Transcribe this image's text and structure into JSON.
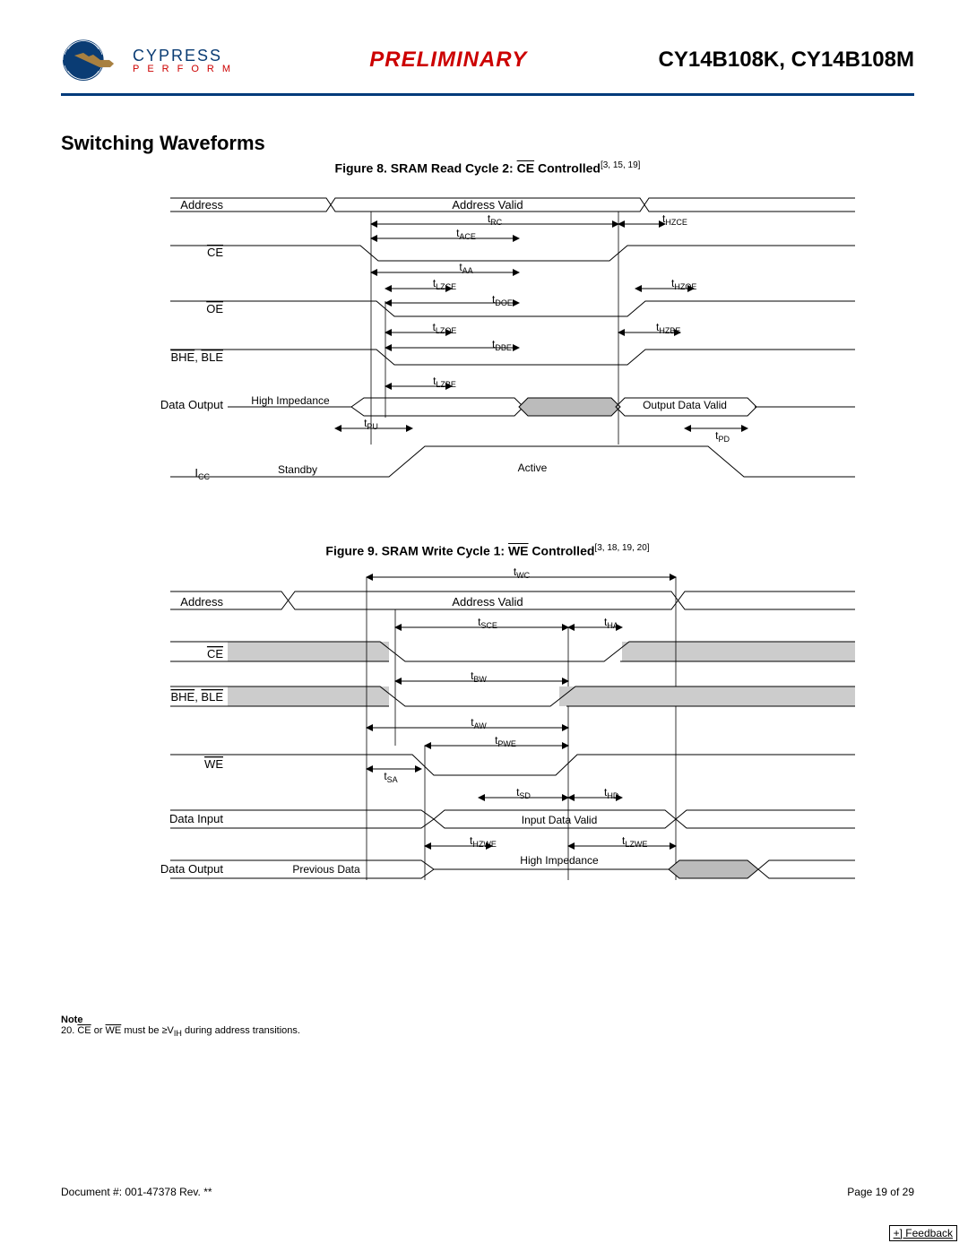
{
  "header": {
    "company": "CYPRESS",
    "tagline": "PERFORM",
    "preliminary": "PRELIMINARY",
    "parts": "CY14B108K, CY14B108M"
  },
  "section_title": "Switching Waveforms",
  "figure8": {
    "caption_prefix": "Figure 8.  SRAM Read Cycle 2: ",
    "caption_bar": "CE",
    "caption_suffix": " Controlled",
    "refs": "[3, 15, 19]",
    "signals": {
      "address": "Address",
      "address_valid": "Address Valid",
      "ce": "CE",
      "oe": "OE",
      "bhe_ble": "BHE, BLE",
      "data_output": "Data Output",
      "high_impedance": "High Impedance",
      "output_data_valid": "Output Data Valid",
      "icc": "I",
      "icc_sub": "CC",
      "standby": "Standby",
      "active": "Active"
    },
    "timing": {
      "tRC": "t",
      "tRC_sub": "RC",
      "tACE": "t",
      "tACE_sub": "ACE",
      "tHZCE": "t",
      "tHZCE_sub": "HZCE",
      "tAA": "t",
      "tAA_sub": "AA",
      "tLZCE": "t",
      "tLZCE_sub": "LZCE",
      "tHZOE": "t",
      "tHZOE_sub": "HZOE",
      "tDOE": "t",
      "tDOE_sub": "DOE",
      "tLZOE": "t",
      "tLZOE_sub": "LZOE",
      "tHZBE": "t",
      "tHZBE_sub": "HZBE",
      "tDBE": "t",
      "tDBE_sub": "DBE",
      "tLZBE": "t",
      "tLZBE_sub": "LZBE",
      "tPU": "t",
      "tPU_sub": "PU",
      "tPD": "t",
      "tPD_sub": "PD"
    }
  },
  "figure9": {
    "caption_prefix": "Figure 9.  SRAM Write Cycle 1: ",
    "caption_bar": "WE",
    "caption_suffix": " Controlled",
    "refs": "[3, 18, 19, 20]",
    "signals": {
      "address": "Address",
      "address_valid": "Address Valid",
      "ce": "CE",
      "bhe_ble": "BHE, BLE",
      "we": "WE",
      "data_input": "Data Input",
      "input_data_valid": "Input Data Valid",
      "data_output": "Data Output",
      "previous_data": "Previous Data",
      "high_impedance": "High Impedance"
    },
    "timing": {
      "tWC": "t",
      "tWC_sub": "WC",
      "tSCE": "t",
      "tSCE_sub": "SCE",
      "tHA": "t",
      "tHA_sub": "HA",
      "tBW": "t",
      "tBW_sub": "BW",
      "tAW": "t",
      "tAW_sub": "AW",
      "tPWE": "t",
      "tPWE_sub": "PWE",
      "tSA": "t",
      "tSA_sub": "SA",
      "tSD": "t",
      "tSD_sub": "SD",
      "tHD": "t",
      "tHD_sub": "HD",
      "tHZWE": "t",
      "tHZWE_sub": "HZWE",
      "tLZWE": "t",
      "tLZWE_sub": "LZWE"
    }
  },
  "note": {
    "head": "Note",
    "num": "20. ",
    "ce": "CE",
    "or": " or ",
    "we": "WE",
    "rest1": " must be ≥V",
    "rest_sub": "IH",
    "rest2": " during address transitions."
  },
  "footer": {
    "doc": "Document #: 001-47378 Rev. **",
    "page": "Page 19 of 29",
    "feedback": "+] Feedback"
  }
}
